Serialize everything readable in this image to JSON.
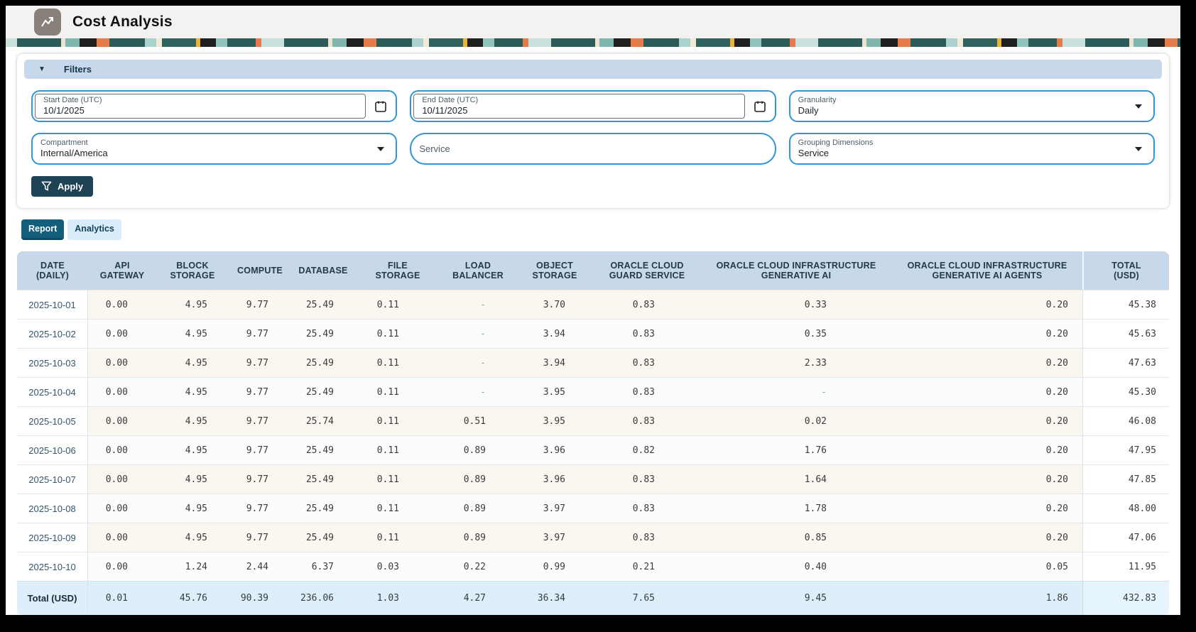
{
  "app": {
    "title": "Cost Analysis"
  },
  "filters": {
    "section_label": "Filters",
    "start_date": {
      "label": "Start Date (UTC)",
      "value": "10/1/2025"
    },
    "end_date": {
      "label": "End Date (UTC)",
      "value": "10/11/2025"
    },
    "granularity": {
      "label": "Granularity",
      "value": "Daily"
    },
    "compartment": {
      "label": "Compartment",
      "value": "Internal/America"
    },
    "service": {
      "label": "Service",
      "value": ""
    },
    "grouping_dimensions": {
      "label": "Grouping Dimensions",
      "value": "Service"
    },
    "apply_label": "Apply"
  },
  "tabs": [
    {
      "label": "Report",
      "active": true
    },
    {
      "label": "Analytics",
      "active": false
    }
  ],
  "report_table": {
    "headers": [
      "DATE\n(DAILY)",
      "API\nGATEWAY",
      "BLOCK\nSTORAGE",
      "COMPUTE",
      "DATABASE",
      "FILE\nSTORAGE",
      "LOAD\nBALANCER",
      "OBJECT\nSTORAGE",
      "ORACLE CLOUD\nGUARD SERVICE",
      "ORACLE CLOUD INFRASTRUCTURE\nGENERATIVE AI",
      "ORACLE CLOUD INFRASTRUCTURE\nGENERATIVE AI AGENTS",
      "TOTAL\n(USD)"
    ],
    "rows": [
      {
        "date": "2025-10-01",
        "values": [
          "0.00",
          "4.95",
          "9.77",
          "25.49",
          "0.11",
          "-",
          "3.70",
          "0.83",
          "0.33",
          "0.20"
        ],
        "total": "45.38"
      },
      {
        "date": "2025-10-02",
        "values": [
          "0.00",
          "4.95",
          "9.77",
          "25.49",
          "0.11",
          "-",
          "3.94",
          "0.83",
          "0.35",
          "0.20"
        ],
        "total": "45.63"
      },
      {
        "date": "2025-10-03",
        "values": [
          "0.00",
          "4.95",
          "9.77",
          "25.49",
          "0.11",
          "-",
          "3.94",
          "0.83",
          "2.33",
          "0.20"
        ],
        "total": "47.63"
      },
      {
        "date": "2025-10-04",
        "values": [
          "0.00",
          "4.95",
          "9.77",
          "25.49",
          "0.11",
          "-",
          "3.95",
          "0.83",
          "-",
          "0.20"
        ],
        "total": "45.30"
      },
      {
        "date": "2025-10-05",
        "values": [
          "0.00",
          "4.95",
          "9.77",
          "25.74",
          "0.11",
          "0.51",
          "3.95",
          "0.83",
          "0.02",
          "0.20"
        ],
        "total": "46.08"
      },
      {
        "date": "2025-10-06",
        "values": [
          "0.00",
          "4.95",
          "9.77",
          "25.49",
          "0.11",
          "0.89",
          "3.96",
          "0.82",
          "1.76",
          "0.20"
        ],
        "total": "47.95"
      },
      {
        "date": "2025-10-07",
        "values": [
          "0.00",
          "4.95",
          "9.77",
          "25.49",
          "0.11",
          "0.89",
          "3.96",
          "0.83",
          "1.64",
          "0.20"
        ],
        "total": "47.85"
      },
      {
        "date": "2025-10-08",
        "values": [
          "0.00",
          "4.95",
          "9.77",
          "25.49",
          "0.11",
          "0.89",
          "3.97",
          "0.83",
          "1.78",
          "0.20"
        ],
        "total": "48.00"
      },
      {
        "date": "2025-10-09",
        "values": [
          "0.00",
          "4.95",
          "9.77",
          "25.49",
          "0.11",
          "0.89",
          "3.97",
          "0.83",
          "0.85",
          "0.20"
        ],
        "total": "47.06"
      },
      {
        "date": "2025-10-10",
        "values": [
          "0.00",
          "1.24",
          "2.44",
          "6.37",
          "0.03",
          "0.22",
          "0.99",
          "0.21",
          "0.40",
          "0.05"
        ],
        "total": "11.95"
      }
    ],
    "total_row": {
      "label": "Total (USD)",
      "values": [
        "0.01",
        "45.76",
        "90.39",
        "236.06",
        "1.03",
        "4.27",
        "36.34",
        "7.65",
        "9.45",
        "1.86"
      ],
      "total": "432.83"
    }
  },
  "colors": {
    "accent_blue_border": "#2e96d8",
    "header_band": "#c6d8ea",
    "apply_button": "#1d4355",
    "active_tab": "#135f7b",
    "total_row_bg": "#ddeffb"
  }
}
